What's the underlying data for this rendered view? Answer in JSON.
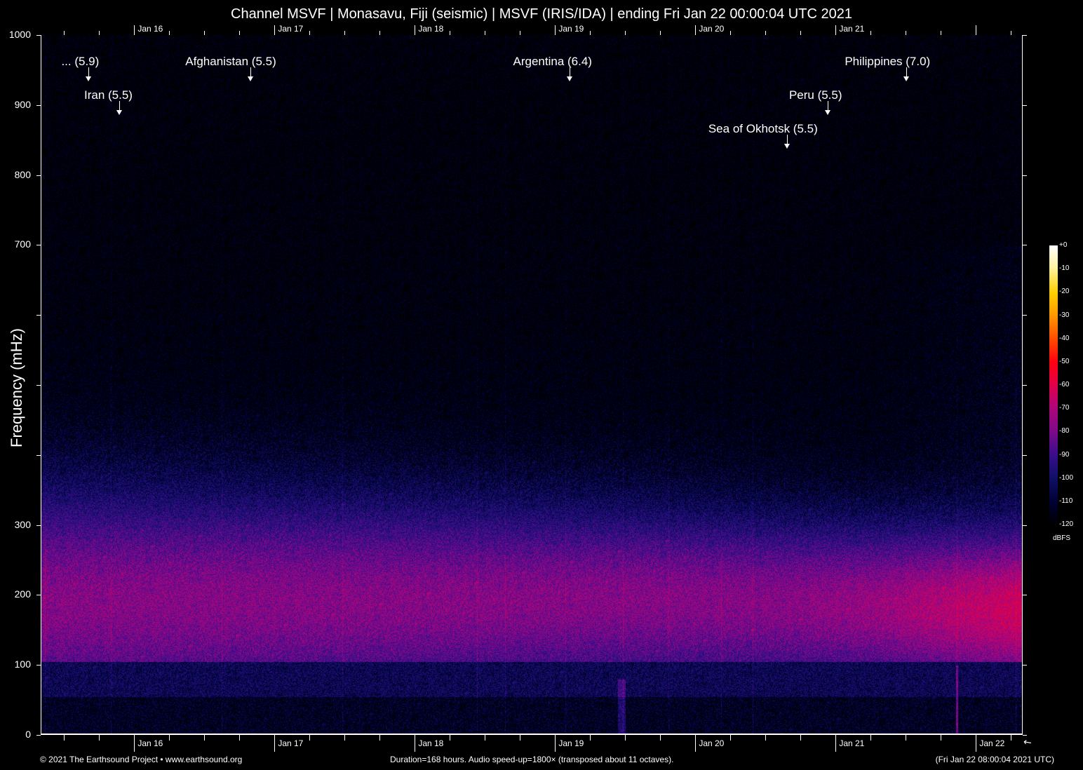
{
  "title": "Channel MSVF | Monasavu, Fiji (seismic) | MSVF (IRIS/IDA) | ending Fri Jan 22 00:00:04 UTC 2021",
  "footer": {
    "copyright": "© 2021 The Earthsound Project • www.earthsound.org",
    "info": "Duration=168 hours. Audio speed-up=1800× (transposed about 11 octaves).",
    "local_time": "(Fri Jan 22 08:00:04 2021 UTC)"
  },
  "chart_data": {
    "type": "heatmap",
    "title": "Channel MSVF | Monasavu, Fiji (seismic) | MSVF (IRIS/IDA) | ending Fri Jan 22 00:00:04 UTC 2021",
    "ylabel": "Frequency (mHz)",
    "ylim": [
      0,
      1000
    ],
    "y_tick_labels": [
      "0",
      "100",
      "200",
      "300",
      "700",
      "800",
      "900",
      "1000"
    ],
    "y_ticks": [
      0,
      100,
      200,
      300,
      400,
      500,
      600,
      700,
      800,
      900,
      1000
    ],
    "x_range_hours": [
      0,
      168
    ],
    "x_tick_labels": [
      {
        "label": "Jan 16",
        "hour": 16
      },
      {
        "label": "Jan 17",
        "hour": 40
      },
      {
        "label": "Jan 18",
        "hour": 64
      },
      {
        "label": "Jan 19",
        "hour": 88
      },
      {
        "label": "Jan 20",
        "hour": 112
      },
      {
        "label": "Jan 21",
        "hour": 136
      },
      {
        "label": "Jan 22",
        "hour": 160
      }
    ],
    "top_tick_labels": [
      "Jan 16",
      "Jan 17",
      "Jan 18",
      "Jan 19",
      "Jan 20",
      "Jan 21"
    ],
    "colorbar": {
      "label": "dBFS",
      "ticks": [
        "+0",
        "-10",
        "-20",
        "-30",
        "-40",
        "-50",
        "-60",
        "-70",
        "-80",
        "-90",
        "-100",
        "-110",
        "-120"
      ],
      "range": [
        -120,
        0
      ]
    },
    "events": [
      {
        "label": "... (5.9)",
        "hour": 8.2
      },
      {
        "label": "Iran (5.5)",
        "hour": 13.4
      },
      {
        "label": "Afghanistan (5.5)",
        "hour": 35.9
      },
      {
        "label": "Argentina (6.4)",
        "hour": 90.5
      },
      {
        "label": "Sea of Okhotsk (5.5)",
        "hour": 127.7
      },
      {
        "label": "Peru (5.5)",
        "hour": 134.6
      },
      {
        "label": "Philippines (7.0)",
        "hour": 148.1
      }
    ]
  }
}
